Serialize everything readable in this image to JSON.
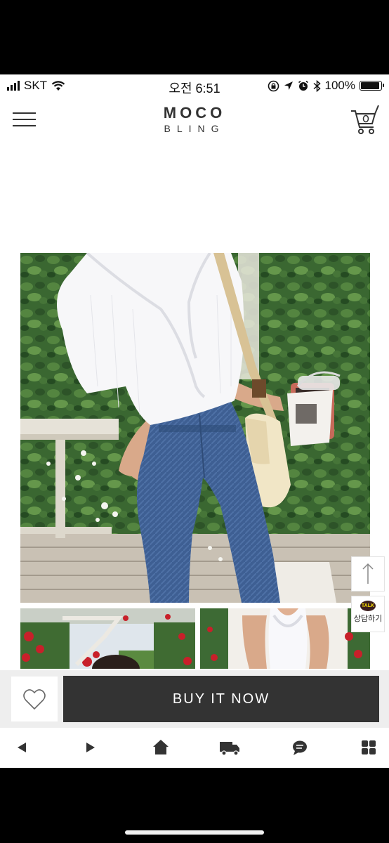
{
  "status_bar": {
    "carrier": "SKT",
    "time": "오전 6:51",
    "battery_percent": "100%",
    "battery_level": 1.0
  },
  "header": {
    "logo_line1": "MOCO",
    "logo_line2": "BLING",
    "icons": [
      "menu-icon",
      "cart-icon"
    ]
  },
  "floating": {
    "scroll_top_icon": "arrow-up-icon",
    "talk_badge": "TALK",
    "talk_label": "상담하기"
  },
  "purchase_bar": {
    "wishlist_icon": "heart-icon",
    "buy_label": "BUY IT NOW"
  },
  "bottom_nav": {
    "items": [
      "back-icon",
      "forward-icon",
      "home-icon",
      "delivery-icon",
      "chat-icon",
      "grid-icon"
    ]
  },
  "colors": {
    "dark_button": "#333333",
    "purchase_bar_bg": "#eeeeee",
    "kakao_bubble": "#3c1e1e",
    "kakao_text": "#f9e000"
  }
}
